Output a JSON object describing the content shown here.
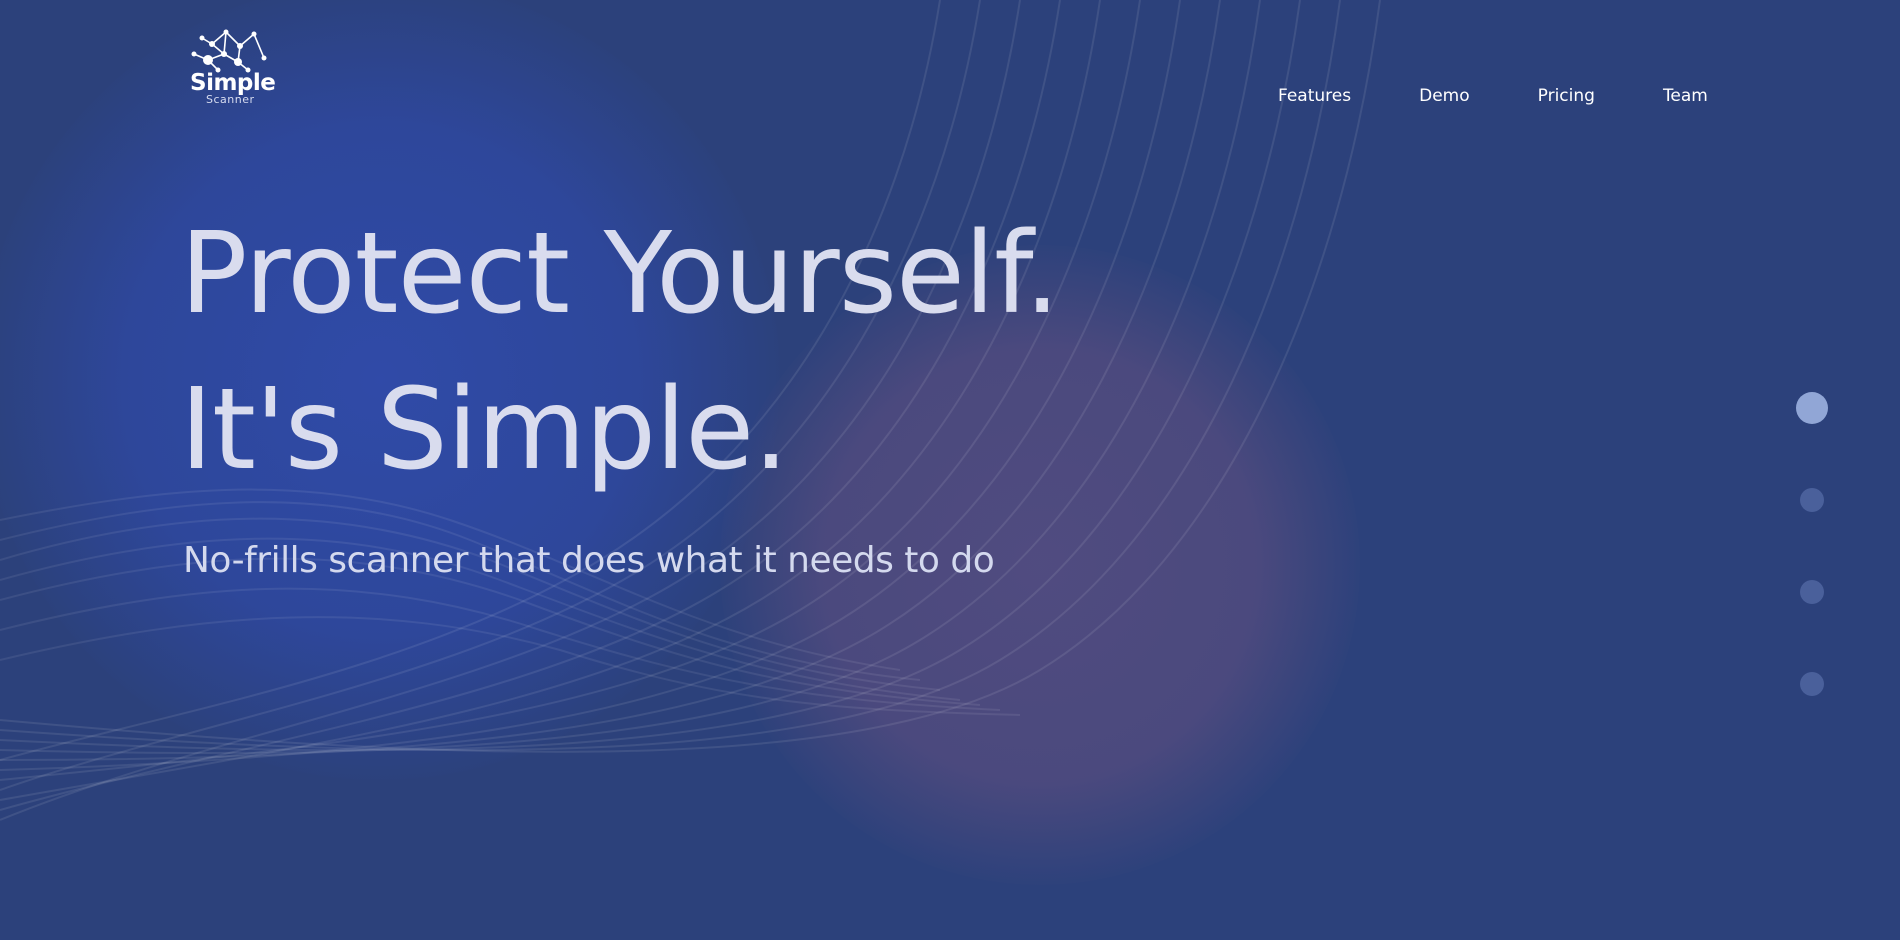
{
  "brand": {
    "name": "Simple",
    "tagline": "Scanner"
  },
  "nav": {
    "items": [
      {
        "label": "Features"
      },
      {
        "label": "Demo"
      },
      {
        "label": "Pricing"
      },
      {
        "label": "Team"
      }
    ]
  },
  "hero": {
    "line1": "Protect Yourself.",
    "line2": "It's Simple.",
    "subtitle": "No-frills scanner that does what it needs to do"
  },
  "section_nav": {
    "count": 4,
    "active_index": 0
  },
  "colors": {
    "background": "#2c417b",
    "blob_blue": "#2f4ba8",
    "blob_purple": "#524c80",
    "text_primary": "#d9dcee",
    "dot_active": "#91a6d6",
    "dot_inactive": "#4a609b"
  },
  "icons": {
    "logo": "network-graph-icon"
  }
}
